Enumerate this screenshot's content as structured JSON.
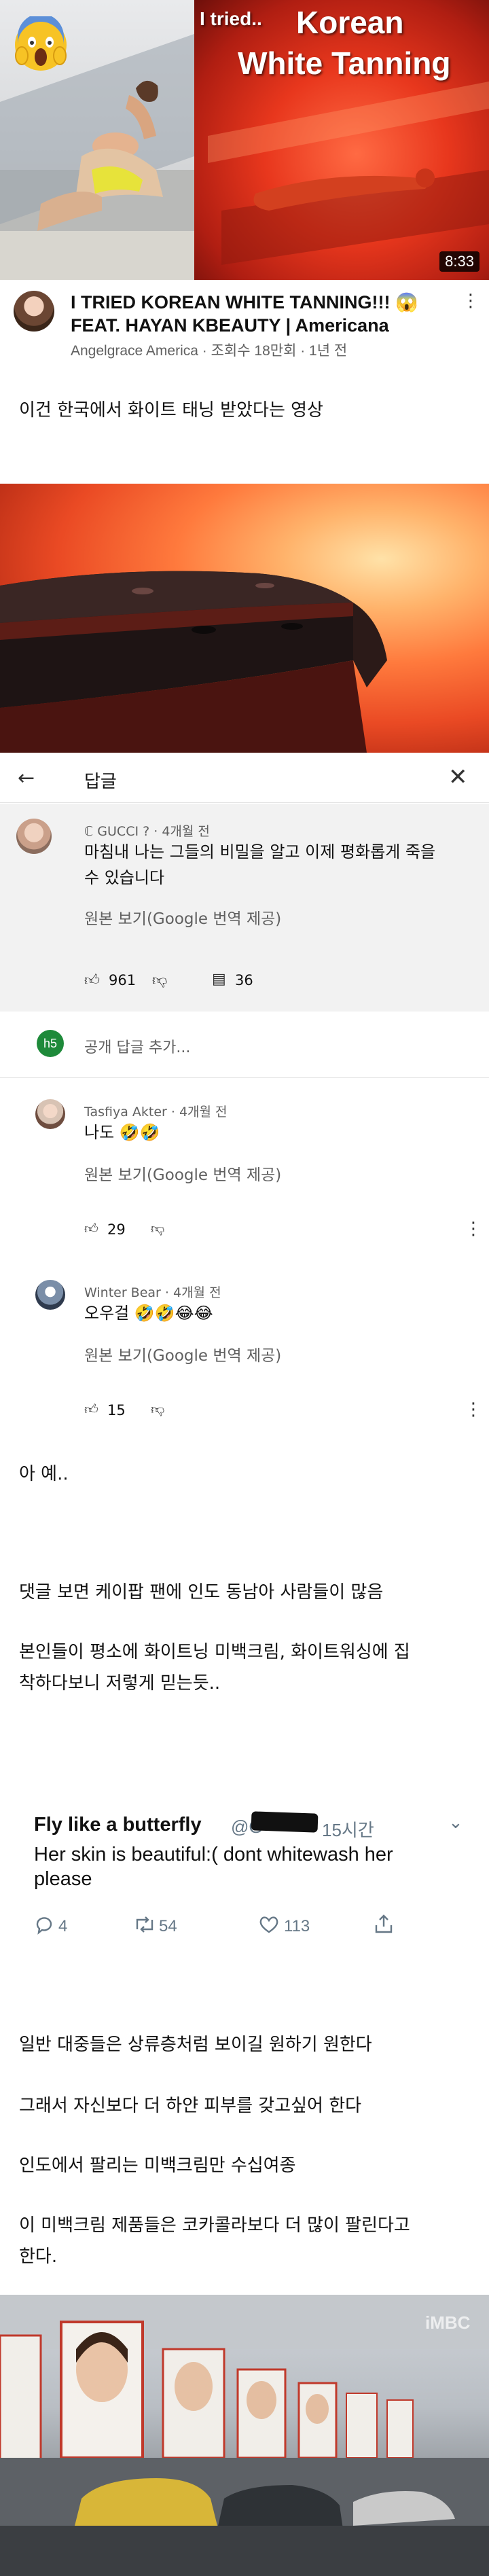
{
  "youtube": {
    "thumbnail_title_line1": "I tried..",
    "thumbnail_title_line2": "Korean",
    "thumbnail_title_line3": "White Tanning",
    "duration": "8:33",
    "title": "I TRIED KOREAN WHITE TANNING!!! 😱 FEAT. HAYAN KBEAUTY | Americana",
    "meta": "Angelgrace America · 조회수 18만회 · 1년 전"
  },
  "captions": {
    "c1": "이건 한국에서 화이트 태닝 받았다는 영상",
    "c2": "아 예..",
    "c3": "댓글 보면 케이팝 팬에 인도 동남아 사람들이 많음",
    "c4_line1": "본인들이 평소에 화이트닝 미백크림, 화이트워싱에 집",
    "c4_line2": "착하다보니 저렇게 믿는듯..",
    "c5": "일반 대중들은 상류층처럼 보이길 원하기 원한다",
    "c6": "그래서 자신보다 더 하얀 피부를 갖고싶어 한다",
    "c7": "인도에서 팔리는 미백크림만 수십여종",
    "c8_line1": "이 미백크림 제품들은 코카콜라보다 더 많이 팔린다고",
    "c8_line2": "한다."
  },
  "replies": {
    "header_title": "답글",
    "parent": {
      "author": "ℂ GUCCI ? · 4개월 전",
      "text_line1": "마침내 나는 그들의 비밀을 알고 이제 평화롭게 죽을",
      "text_line2": "수 있습니다",
      "translate": "원본 보기(Google 번역 제공)",
      "likes": "961",
      "replies": "36"
    },
    "add_reply_avatar": "h5",
    "add_reply_placeholder": "공개 답글 추가...",
    "items": [
      {
        "author": "Tasfiya Akter · 4개월 전",
        "text": "나도 🤣🤣",
        "translate": "원본 보기(Google 번역 제공)",
        "likes": "29"
      },
      {
        "author": "Winter Bear · 4개월 전",
        "text": "오우걸 🤣🤣😂😂",
        "translate": "원본 보기(Google 번역 제공)",
        "likes": "15"
      }
    ]
  },
  "tweet": {
    "name": "Fly like a butterfly",
    "handle": "@G",
    "time": "15시간",
    "text_line1": "Her skin is beautiful:( dont whitewash her",
    "text_line2": "please",
    "replies": "4",
    "retweets": "54",
    "likes": "113"
  },
  "billboard_watermark": "iMBC",
  "colors": {
    "yt_red_glow": "#e8371d",
    "reply_bg": "#f2f2f2",
    "avatar_green": "#1e8a3a",
    "twitter_gray": "#657786"
  }
}
